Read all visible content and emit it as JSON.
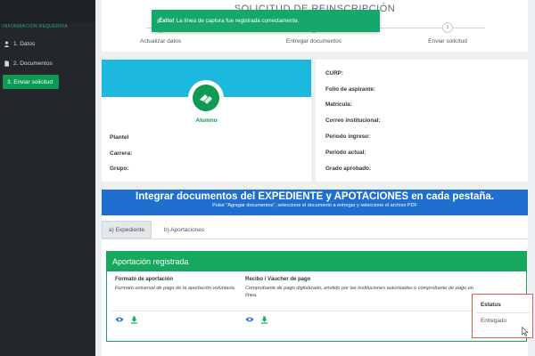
{
  "sidebar": {
    "header": "INFORMACIÓN REQUERIDA",
    "items": [
      {
        "label": "1. Datos",
        "icon": "user-icon"
      },
      {
        "label": "2. Documentos",
        "icon": "document-icon"
      },
      {
        "label": "3. Enviar solicitud",
        "icon": ""
      }
    ]
  },
  "stepper": {
    "title": "SOLICITUD DE REINSCRIPCIÓN",
    "steps": [
      {
        "label": "Actualizar datos"
      },
      {
        "label": "Entregar documentos"
      },
      {
        "label": "Enviar solicitud",
        "number": "3"
      }
    ]
  },
  "toast": {
    "strong": "¡Éxito!",
    "message": "La línea de captura fue registrada correctamente."
  },
  "profile": {
    "name": "Alumno",
    "fields": [
      "Plantel",
      "Carrera:",
      "Grupo:"
    ]
  },
  "details": {
    "fields": [
      "CURP:",
      "Folio de aspirante:",
      "Matrícula:",
      "Correo institucional:",
      "Periodo ingreso:",
      "Periodo actual:",
      "Grado aprobado:"
    ]
  },
  "doc_banner": {
    "title": "Integrar documentos del EXPEDIENTE y APOTACIONES en cada pestaña.",
    "subtitle": "Pulse \"Agregar documentos\", seleccione el documento a entregar y seleccione el archivo PDF"
  },
  "tabs": [
    {
      "label": "a) Expediente"
    },
    {
      "label": "b) Aportaciones"
    }
  ],
  "aportacion": {
    "header": "Aportación registrada",
    "columns": [
      {
        "title": "Formato de aportación",
        "desc": "Formato universal de pago de la aportación voluntaria."
      },
      {
        "title": "Recibo / Váucher de pago",
        "desc": "Comprobante de pago digitalizado, emitido por las instituciones autorizadas o comprobante de pago en línea."
      }
    ],
    "status": {
      "title": "Estatus",
      "value": "Entregado"
    }
  },
  "colors": {
    "sidebar_bg": "#23272c",
    "accent_green": "#16a85d",
    "banner_blue": "#1f6fd1",
    "profile_cyan": "#1db8dd",
    "highlight_red": "#e05a5a"
  }
}
